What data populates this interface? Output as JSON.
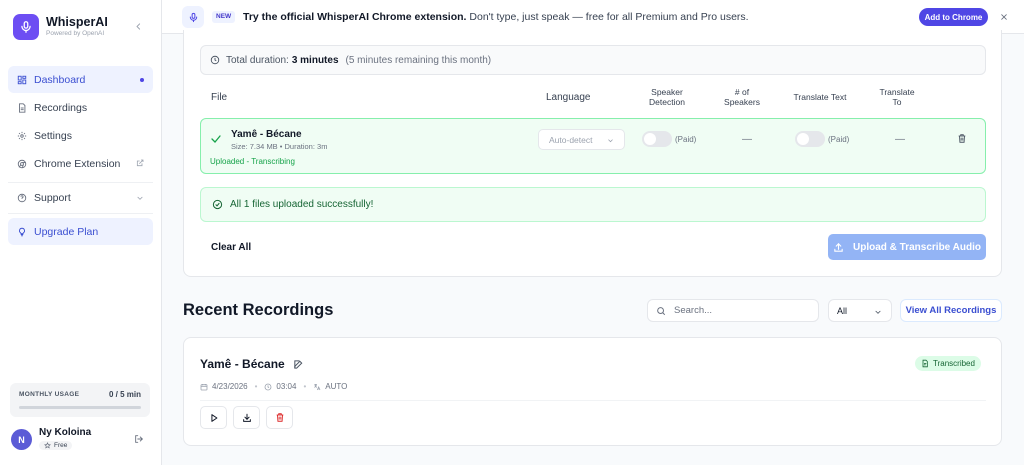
{
  "sidebar": {
    "brand_name": "WhisperAI",
    "brand_sub": "Powered by OpenAI",
    "items": [
      {
        "label": "Dashboard"
      },
      {
        "label": "Recordings"
      },
      {
        "label": "Settings"
      },
      {
        "label": "Chrome Extension"
      },
      {
        "label": "Support"
      },
      {
        "label": "Upgrade Plan"
      }
    ],
    "usage_label": "MONTHLY USAGE",
    "usage_value": "0 / 5 min",
    "usage_fraction": 0,
    "user_initial": "N",
    "user_name": "Ny Koloina",
    "user_plan": "Free"
  },
  "banner": {
    "badge": "NEW",
    "headline": "Try the official WhisperAI Chrome extension.",
    "text": "Don't type, just speak — free for all Premium and Pro users.",
    "button": "Add to Chrome"
  },
  "upload": {
    "duration_label": "Total duration:",
    "duration_value": "3 minutes",
    "duration_remaining": "(5 minutes remaining this month)",
    "columns": {
      "file": "File",
      "language": "Language",
      "speaker_detection": "Speaker Detection",
      "num_speakers": "# of Speakers",
      "translate_text": "Translate Text",
      "translate_to": "Translate To"
    },
    "file": {
      "name": "Yamê - Bécane",
      "size": "Size: 7.34 MB",
      "duration": "• Duration: 3m",
      "status": "Uploaded - Transcribing",
      "language": "Auto-detect",
      "speaker_paid": "(Paid)",
      "speakers": "—",
      "translate_paid": "(Paid)",
      "translate_to": "—"
    },
    "success_message": "All 1 files uploaded successfully!",
    "clear_all": "Clear All",
    "upload_button": "Upload & Transcribe Audio"
  },
  "recent": {
    "title": "Recent Recordings",
    "search_placeholder": "Search...",
    "filter_value": "All",
    "view_all": "View All Recordings",
    "recording": {
      "name": "Yamê - Bécane",
      "status": "Transcribed",
      "date": "4/23/2026",
      "duration": "03:04",
      "language": "AUTO"
    }
  },
  "colors": {
    "accent": "#4f46e5",
    "brand": "#6d4ef3",
    "success": "#16a34a",
    "delete": "#dc2626"
  }
}
